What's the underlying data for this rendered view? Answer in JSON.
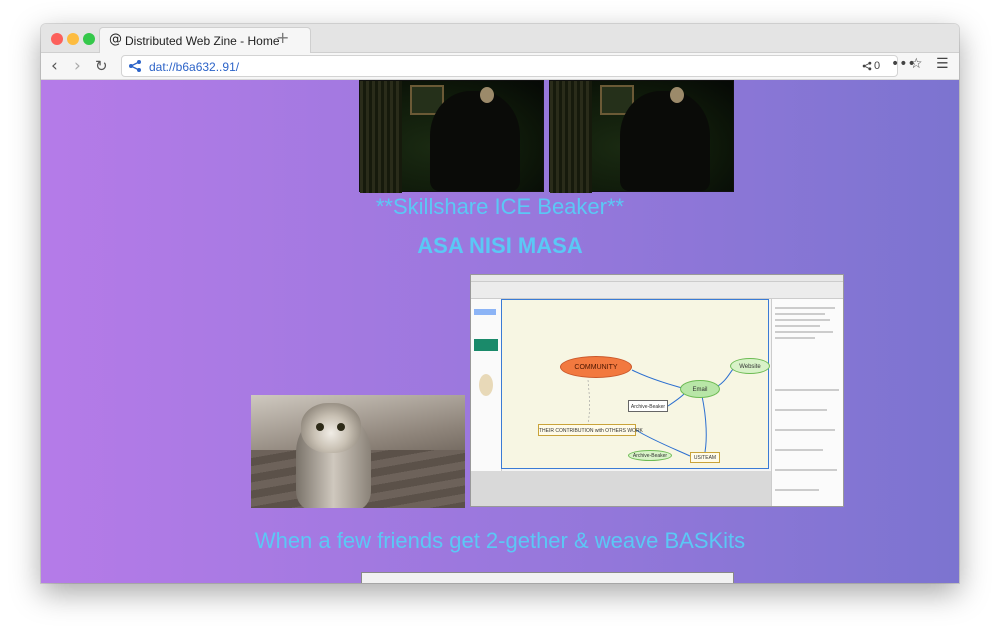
{
  "browser": {
    "tab_title": "Distributed Web Zine - Home",
    "tab_icon": "@",
    "new_tab": "+",
    "url": "dat://b6a632..91/",
    "peer_count": "0"
  },
  "page": {
    "heading_1": "**Skillshare ICE Beaker**",
    "heading_2": "ASA NISI MASA",
    "caption": "When a few friends get 2-gether & weave BASKits",
    "mindmap": {
      "community": "COMMUNITY",
      "email": "Email",
      "website": "Website",
      "archive": "Archive-Beaker",
      "their": "THEIR CONTRIBUTION with OTHERS WORK",
      "us": "US/TEAM",
      "archive2": "Archive-Beaker"
    }
  },
  "colors": {
    "gradient_start": "#b57be8",
    "gradient_end": "#7c74d0",
    "heading": "#5bc8f5",
    "url": "#2c63c8"
  }
}
